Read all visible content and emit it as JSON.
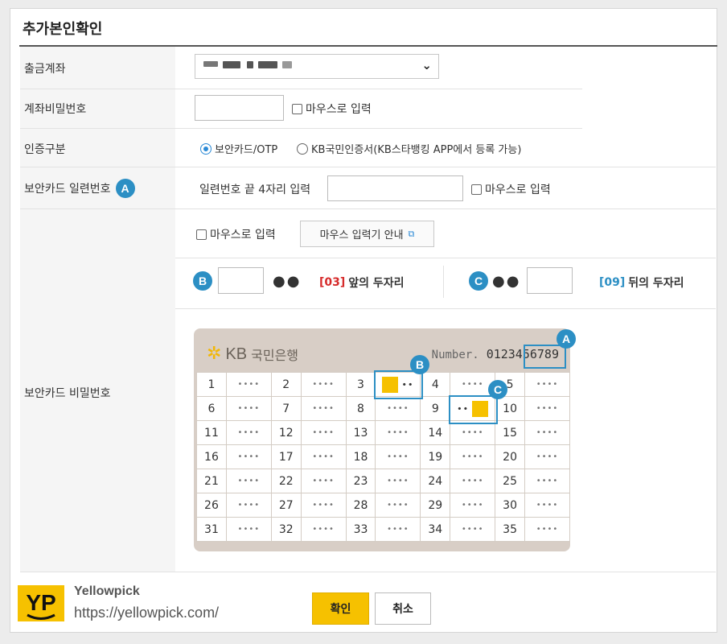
{
  "title": "추가본인확인",
  "labels": {
    "account": "출금계좌",
    "password": "계좌비밀번호",
    "auth_type": "인증구분",
    "serial": "보안카드 일련번호",
    "secret": "보안카드 비밀번호"
  },
  "badges": {
    "a": "A",
    "b": "B",
    "c": "C"
  },
  "mouse_input": "마우스로 입력",
  "auth": {
    "option1": "보안카드/OTP",
    "option2": "KB국민인증서(KB스타뱅킹 APP에서 등록 가능)",
    "selected": "option1"
  },
  "serial": {
    "prompt": "일련번호 끝 4자리 입력"
  },
  "mouse_guide_button": "마우스 입력기 안내",
  "hints": {
    "dots": "●●",
    "front_num": "[03]",
    "front_text": "앞의 두자리",
    "back_num": "[09]",
    "back_text": "뒤의 두자리"
  },
  "card": {
    "bank": "국민은행",
    "kb": "KB",
    "number_label": "Number.",
    "number": "0123456789",
    "mask": "••••",
    "rows": [
      [
        "1",
        "2",
        "3",
        "4",
        "5"
      ],
      [
        "6",
        "7",
        "8",
        "9",
        "10"
      ],
      [
        "11",
        "12",
        "13",
        "14",
        "15"
      ],
      [
        "16",
        "17",
        "18",
        "19",
        "20"
      ],
      [
        "21",
        "22",
        "23",
        "24",
        "25"
      ],
      [
        "26",
        "27",
        "28",
        "29",
        "30"
      ],
      [
        "31",
        "32",
        "33",
        "34",
        "35"
      ]
    ],
    "highlight_dots": "••"
  },
  "buttons": {
    "ok": "확인",
    "cancel": "취소"
  },
  "watermark": {
    "logo": "YP",
    "name": "Yellowpick",
    "url": "https://yellowpick.com/"
  },
  "colors": {
    "accent": "#2c8fc4",
    "button": "#f6c100",
    "front_num": "#d62b2b",
    "back_num": "#2c8fc4"
  }
}
